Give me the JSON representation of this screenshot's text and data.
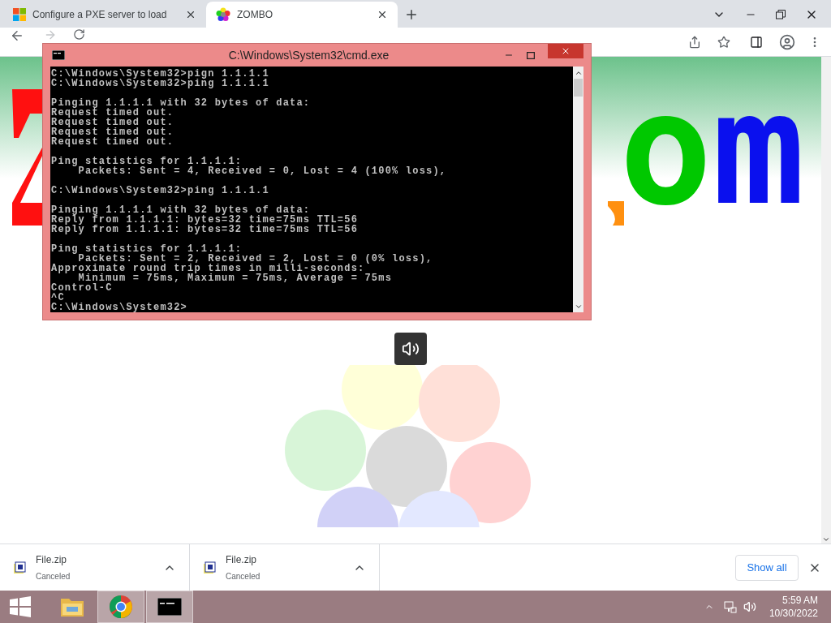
{
  "browser": {
    "tabs": [
      {
        "title": "Configure a PXE server to load",
        "selected": false
      },
      {
        "title": "ZOMBO",
        "selected": true
      }
    ]
  },
  "page": {
    "logo": [
      {
        "text": "o",
        "color": "#00c800"
      },
      {
        "text": "m",
        "color": "#0a10ee"
      }
    ]
  },
  "console_window": {
    "title": "C:\\Windows\\System32\\cmd.exe",
    "blocks": [
      [
        "C:\\Windows\\System32>pign 1.1.1.1",
        "C:\\Windows\\System32>ping 1.1.1.1"
      ],
      [
        "Pinging 1.1.1.1 with 32 bytes of data:",
        "Request timed out.",
        "Request timed out.",
        "Request timed out.",
        "Request timed out."
      ],
      [
        "Ping statistics for 1.1.1.1:",
        "    Packets: Sent = 4, Received = 0, Lost = 4 (100% loss),"
      ],
      [
        "C:\\Windows\\System32>ping 1.1.1.1"
      ],
      [
        "Pinging 1.1.1.1 with 32 bytes of data:",
        "Reply from 1.1.1.1: bytes=32 time=75ms TTL=56",
        "Reply from 1.1.1.1: bytes=32 time=75ms TTL=56"
      ],
      [
        "Ping statistics for 1.1.1.1:",
        "    Packets: Sent = 2, Received = 2, Lost = 0 (0% loss),",
        "Approximate round trip times in milli-seconds:",
        "    Minimum = 75ms, Maximum = 75ms, Average = 75ms",
        "Control-C",
        "^C",
        "C:\\Windows\\System32>"
      ]
    ]
  },
  "downloads": {
    "items": [
      {
        "name": "File.zip",
        "status": "Canceled"
      },
      {
        "name": "File.zip",
        "status": "Canceled"
      }
    ],
    "show_all": "Show all"
  },
  "taskbar": {
    "apps": [
      {
        "kind": "explorer",
        "selected": false
      },
      {
        "kind": "chrome",
        "selected": true
      },
      {
        "kind": "console",
        "selected": true
      }
    ],
    "time": "5:59 AM",
    "date": "10/30/2022"
  }
}
